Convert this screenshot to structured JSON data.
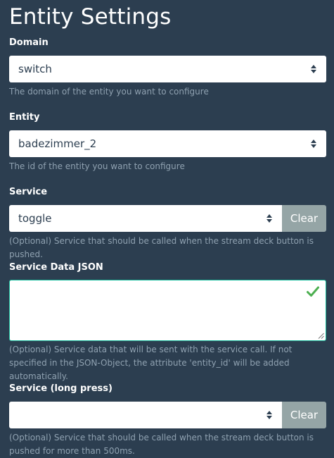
{
  "title": "Entity Settings",
  "domain": {
    "label": "Domain",
    "value": "switch",
    "help": "The domain of the entity you want to configure"
  },
  "entity": {
    "label": "Entity",
    "value": "badezimmer_2",
    "help": "The id of the entity you want to configure"
  },
  "service": {
    "label": "Service",
    "value": "toggle",
    "clear_label": "Clear",
    "help": "(Optional) Service that should be called when the stream deck button is pushed."
  },
  "service_data": {
    "label": "Service Data JSON",
    "value": "",
    "help": "(Optional) Service data that will be sent with the service call. If not specified in the JSON-Object, the attribute 'entity_id' will be added automatically."
  },
  "service_long": {
    "label": "Service (long press)",
    "value": "",
    "clear_label": "Clear",
    "help": "(Optional) Service that should be called when the stream deck button is pushed for more than 500ms."
  },
  "colors": {
    "background": "#2c3e50",
    "help_text": "#8fa1b0",
    "button": "#95a5a6",
    "valid": "#18bc9c"
  }
}
